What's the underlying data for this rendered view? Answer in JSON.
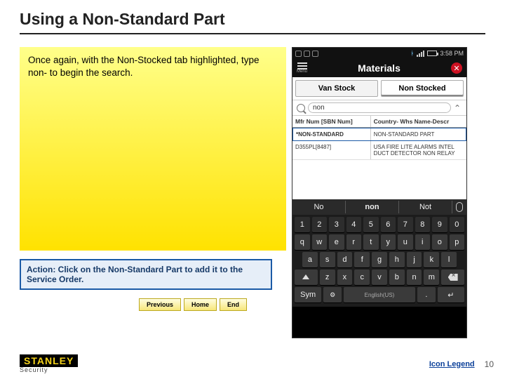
{
  "title": "Using a Non-Standard Part",
  "callout_text": "Once again, with the Non-Stocked tab highlighted, type non- to begin the search.",
  "action_text": "Action:  Click on the Non-Standard Part to add it to the Service Order.",
  "nav": {
    "prev": "Previous",
    "home": "Home",
    "end": "End"
  },
  "footer": {
    "logo_top": "STANLEY",
    "logo_sub": "Security",
    "legend": "Icon Legend",
    "page": "10"
  },
  "phone": {
    "time": "3:58 PM",
    "menu": "Menu",
    "app_title": "Materials",
    "tabs": {
      "van": "Van Stock",
      "non": "Non Stocked"
    },
    "search_value": "non",
    "headers": {
      "c1": "Mfr Num [SBN Num]",
      "c2": "Country- Whs Name-Descr"
    },
    "rows": [
      {
        "c1": "*NON-STANDARD",
        "c2": "NON-STANDARD PART"
      },
      {
        "c1": "D355PL[8487]",
        "c2": "USA FIRE LITE ALARMS INTEL DUCT DETECTOR NON RELAY"
      }
    ],
    "suggest": {
      "a": "No",
      "b": "non",
      "c": "Not"
    },
    "kbd": {
      "nums": [
        "1",
        "2",
        "3",
        "4",
        "5",
        "6",
        "7",
        "8",
        "9",
        "0"
      ],
      "r1": [
        "q",
        "w",
        "e",
        "r",
        "t",
        "y",
        "u",
        "i",
        "o",
        "p"
      ],
      "r2": [
        "a",
        "s",
        "d",
        "f",
        "g",
        "h",
        "j",
        "k",
        "l"
      ],
      "r3": [
        "z",
        "x",
        "c",
        "v",
        "b",
        "n",
        "m"
      ],
      "sym": "Sym",
      "lang": "English(US)",
      "dot": "."
    }
  }
}
